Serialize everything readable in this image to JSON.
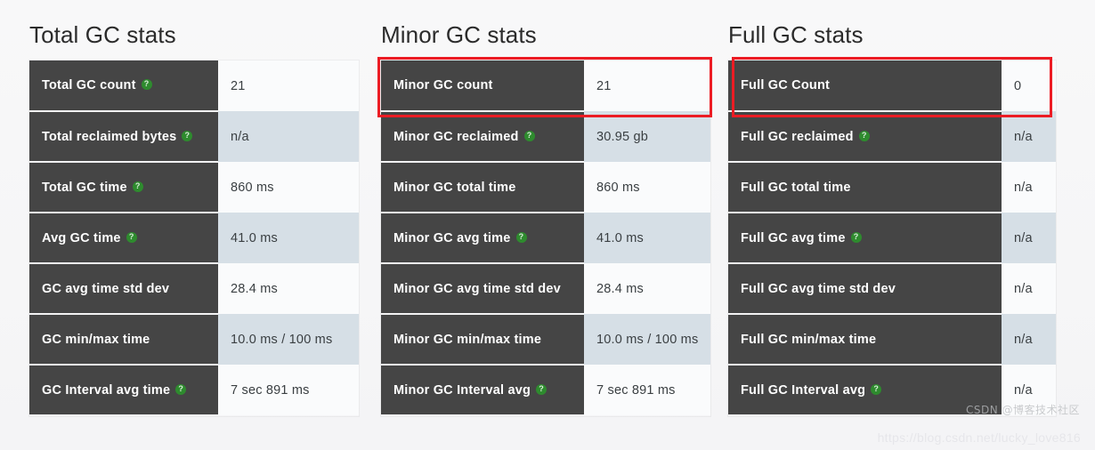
{
  "panels": [
    {
      "title": "Total GC stats",
      "rows": [
        {
          "label": "Total GC count",
          "has_info": true,
          "value": "21"
        },
        {
          "label": "Total reclaimed bytes",
          "has_info": true,
          "value": "n/a"
        },
        {
          "label": "Total GC time",
          "has_info": true,
          "value": "860 ms"
        },
        {
          "label": "Avg GC time",
          "has_info": true,
          "value": "41.0 ms"
        },
        {
          "label": "GC avg time std dev",
          "has_info": false,
          "value": "28.4 ms"
        },
        {
          "label": "GC min/max time",
          "has_info": false,
          "value": "10.0 ms / 100 ms"
        },
        {
          "label": "GC Interval avg time",
          "has_info": true,
          "value": "7 sec 891 ms"
        }
      ]
    },
    {
      "title": "Minor GC stats",
      "rows": [
        {
          "label": "Minor GC count",
          "has_info": false,
          "value": "21"
        },
        {
          "label": "Minor GC reclaimed",
          "has_info": true,
          "value": "30.95 gb"
        },
        {
          "label": "Minor GC total time",
          "has_info": false,
          "value": "860 ms"
        },
        {
          "label": "Minor GC avg time",
          "has_info": true,
          "value": "41.0 ms"
        },
        {
          "label": "Minor GC avg time std dev",
          "has_info": false,
          "value": "28.4 ms"
        },
        {
          "label": "Minor GC min/max time",
          "has_info": false,
          "value": "10.0 ms / 100 ms"
        },
        {
          "label": "Minor GC Interval avg",
          "has_info": true,
          "value": "7 sec 891 ms"
        }
      ]
    },
    {
      "title": "Full GC stats",
      "rows": [
        {
          "label": "Full GC Count",
          "has_info": false,
          "value": "0"
        },
        {
          "label": "Full GC reclaimed",
          "has_info": true,
          "value": "n/a"
        },
        {
          "label": "Full GC total time",
          "has_info": false,
          "value": "n/a"
        },
        {
          "label": "Full GC avg time",
          "has_info": true,
          "value": "n/a"
        },
        {
          "label": "Full GC avg time std dev",
          "has_info": false,
          "value": "n/a"
        },
        {
          "label": "Full GC min/max time",
          "has_info": false,
          "value": "n/a"
        },
        {
          "label": "Full GC Interval avg",
          "has_info": true,
          "value": "n/a"
        }
      ]
    }
  ],
  "annotations": {
    "highlight_color": "#ec1c24",
    "highlighted_rows": [
      "Minor GC count",
      "Full GC Count"
    ]
  },
  "watermark": {
    "url": "https://blog.csdn.net/lucky_love816",
    "logo_text": "CSDN @博客技术社区"
  },
  "theme": {
    "label_bg": "#454545",
    "value_bg_odd": "#fafbfc",
    "value_bg_even": "#d6dfe6",
    "info_icon_color": "#2e8b2e",
    "page_bg": "#f7f7f8"
  }
}
